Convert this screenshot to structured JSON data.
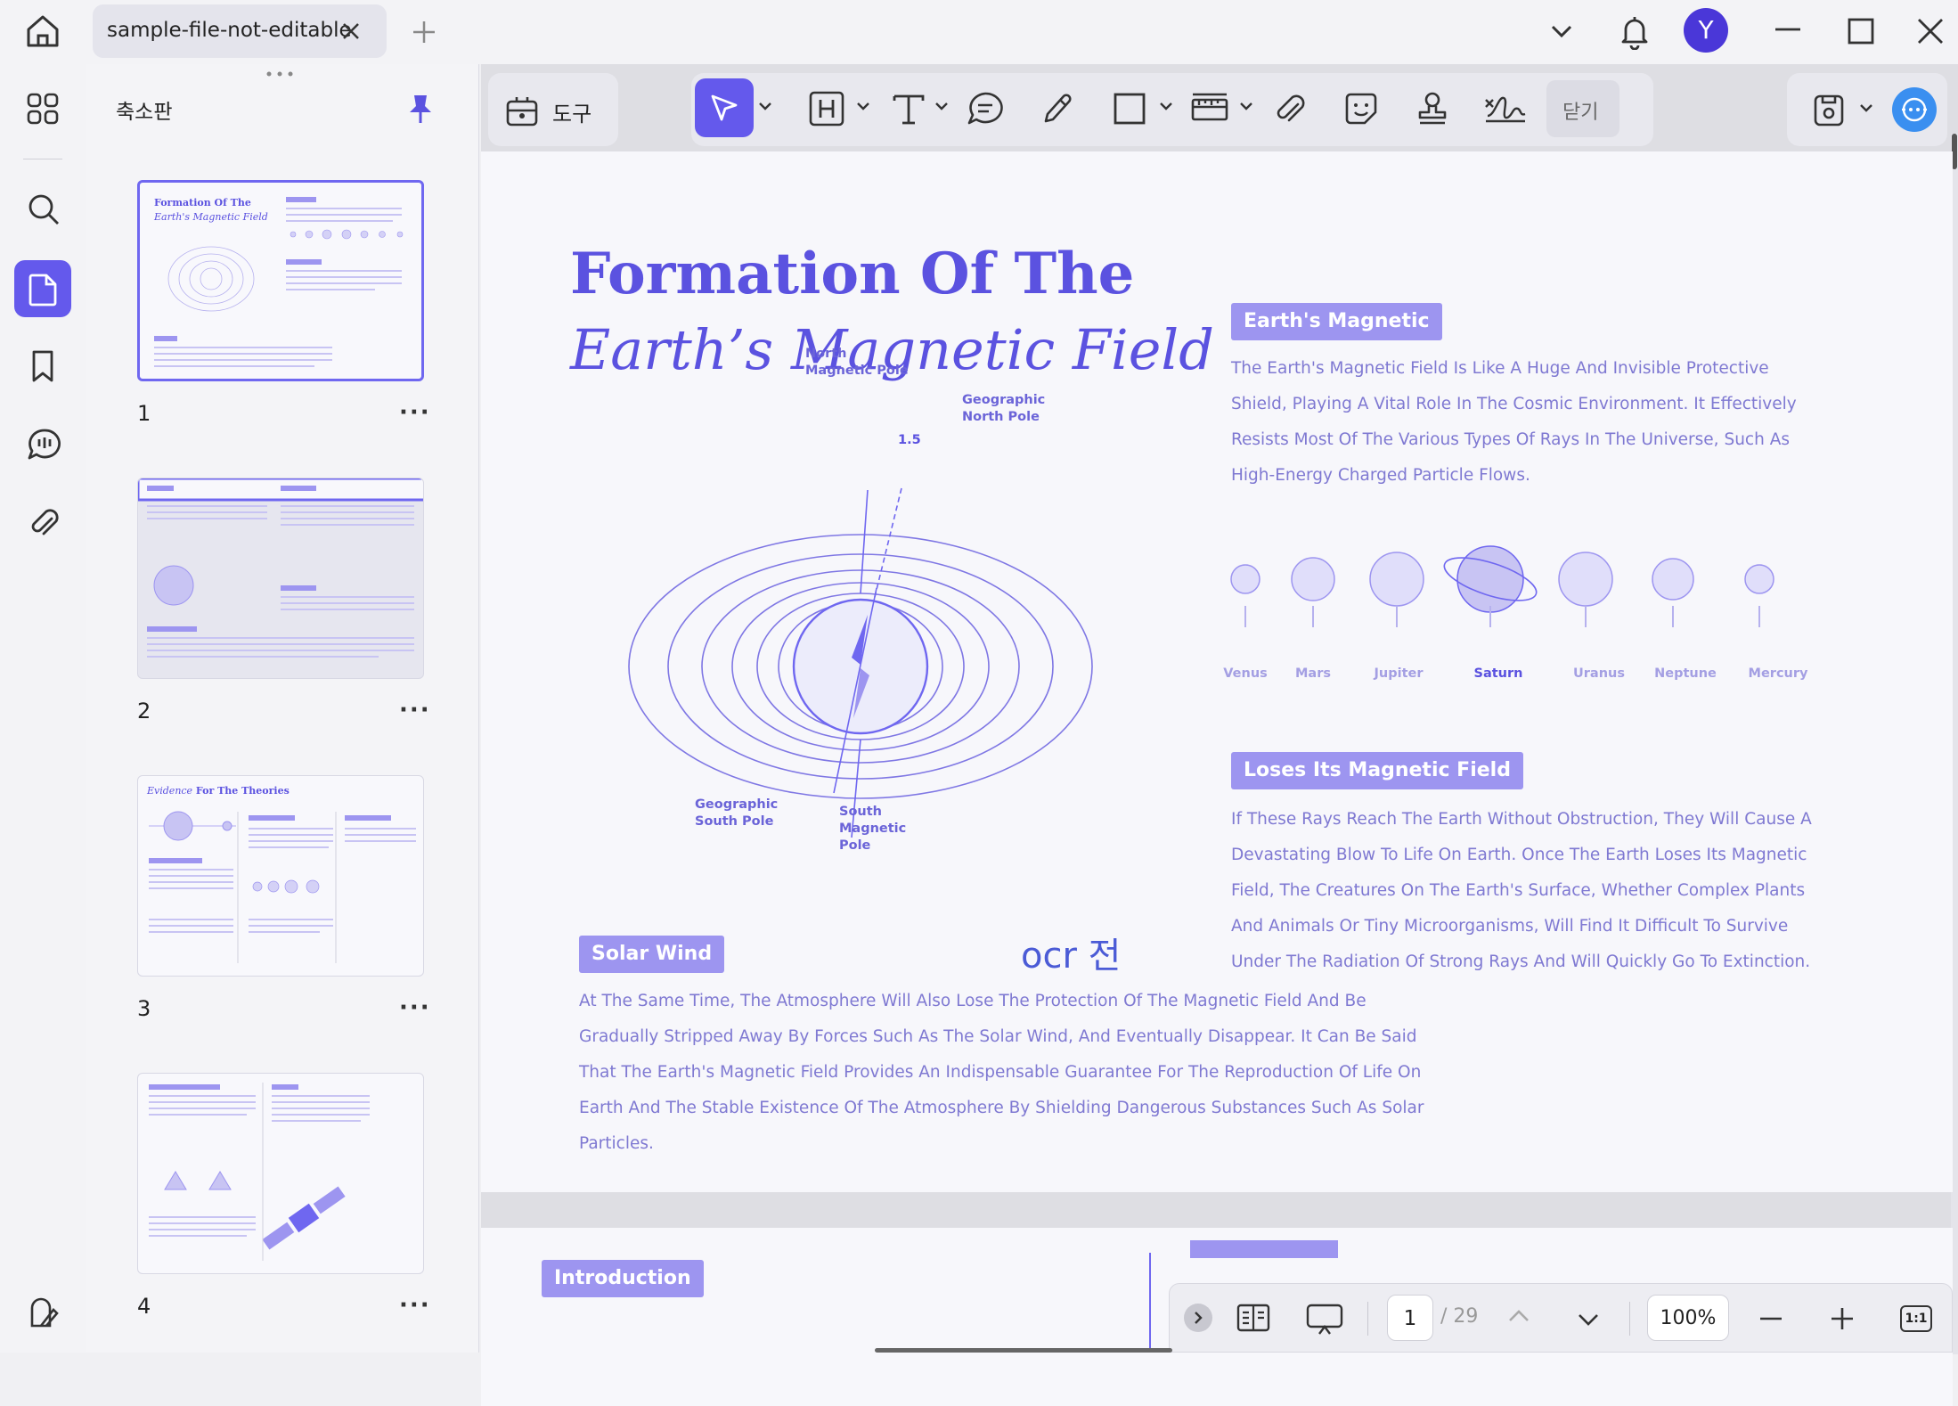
{
  "titlebar": {
    "tab_label": "sample-file-not-editable",
    "avatar_letter": "Y"
  },
  "sidebar": {
    "panel_title": "축소판",
    "thumbnails": [
      {
        "page": "1"
      },
      {
        "page": "2"
      },
      {
        "page": "3"
      },
      {
        "page": "4"
      }
    ],
    "thumb3_title_italic": "Evidence",
    "thumb3_title_rest": " For The Theories",
    "thumb1_title1": "Formation Of The",
    "thumb1_title2": "Earth's Magnetic Field"
  },
  "toolbar": {
    "tools_label": "도구",
    "close_label": "닫기"
  },
  "document": {
    "title_line1": "Formation Of The",
    "title_line2": "Earth’s Magnetic Field",
    "section1_heading": "Earth's Magnetic",
    "section1_body": "The Earth's Magnetic Field Is Like A Huge And Invisible Protective Shield, Playing A Vital Role In The Cosmic Environment. It Effectively Resists Most Of The Various Types Of Rays In The Universe, Such As High-Energy Charged Particle Flows.",
    "planets": [
      "Venus",
      "Mars",
      "Jupiter",
      "Saturn",
      "Uranus",
      "Neptune",
      "Mercury"
    ],
    "section2_heading": "Loses Its Magnetic Field",
    "section2_body": "If These Rays Reach The Earth Without Obstruction, They Will Cause A Devastating Blow To Life On Earth. Once The Earth Loses Its Magnetic Field, The Creatures On The Earth's Surface, Whether Complex Plants And Animals Or Tiny Microorganisms, Will Find It Difficult To Survive Under The Radiation Of Strong Rays And Will Quickly Go To Extinction.",
    "section3_heading": "Solar Wind",
    "ocr_label": "ocr 전",
    "section3_body": "At The Same Time, The Atmosphere Will Also Lose The Protection Of The Magnetic Field And Be Gradually Stripped Away By Forces Such As The Solar Wind, And Eventually Disappear. It Can Be Said That The Earth's Magnetic Field Provides An Indispensable Guarantee For The Reproduction Of Life On Earth And The Stable Existence Of The Atmosphere By Shielding Dangerous Substances Such As Solar Particles.",
    "diagram": {
      "north_magnetic_pole": [
        "North",
        "Magnetic Pole"
      ],
      "geographic_north_pole": [
        "Geographic",
        "North Pole"
      ],
      "geographic_south_pole": [
        "Geographic",
        "South Pole"
      ],
      "south_magnetic_pole": [
        "South",
        "Magnetic",
        "Pole"
      ],
      "angle": "1.5"
    },
    "page2_heading": "Introduction"
  },
  "navbar": {
    "current_page": "1",
    "total_pages": "/ 29",
    "zoom": "100%",
    "fit_label": "1:1"
  },
  "colors": {
    "accent": "#6459ec",
    "brand_purple": "#5b52e0",
    "tag_bg": "#9d95f0",
    "body_text": "#7f79d2"
  }
}
